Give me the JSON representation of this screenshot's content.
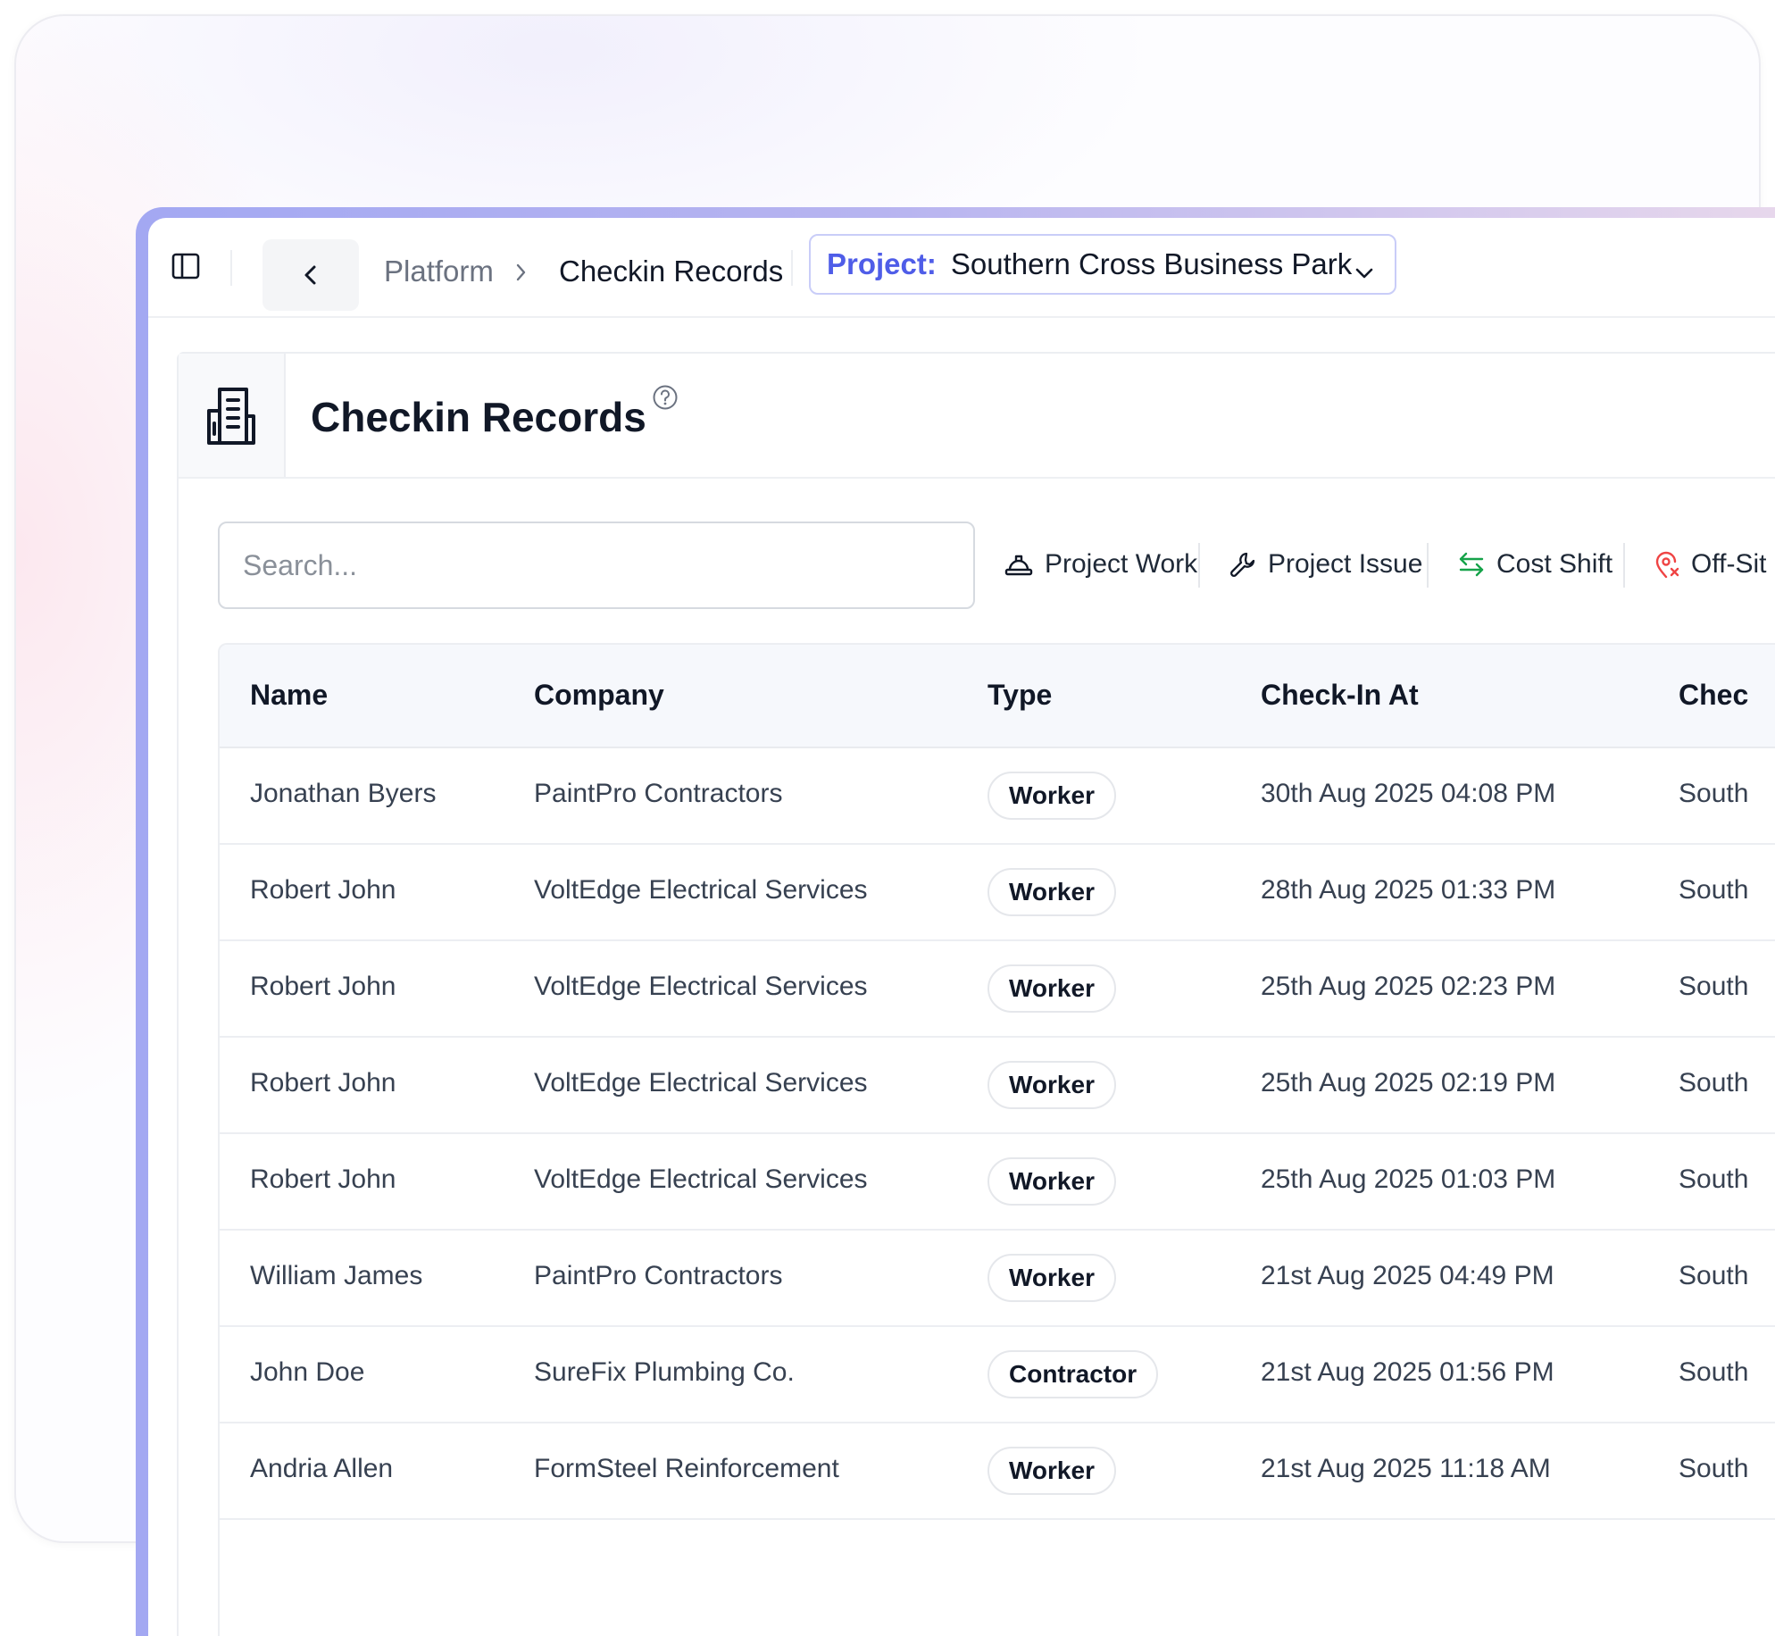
{
  "topbar": {
    "breadcrumb": [
      "Platform",
      "Checkin Records"
    ],
    "project_label": "Project:",
    "project_value": "Southern Cross Business Park"
  },
  "page": {
    "title": "Checkin Records"
  },
  "search": {
    "placeholder": "Search..."
  },
  "actions": [
    {
      "label": "Project Work",
      "icon": "hard-hat-icon"
    },
    {
      "label": "Project Issue",
      "icon": "wrench-icon"
    },
    {
      "label": "Cost Shift",
      "icon": "arrows-swap-icon"
    },
    {
      "label": "Off-Sit",
      "icon": "location-off-icon"
    }
  ],
  "colors": {
    "accent": "#4f5de8",
    "offsite_icon": "#ef4444",
    "cost_shift_icon": "#16a34a"
  },
  "table": {
    "columns": [
      "Name",
      "Company",
      "Type",
      "Check-In At",
      "Chec"
    ],
    "rows": [
      {
        "name": "Jonathan Byers",
        "company": "PaintPro Contractors",
        "type": "Worker",
        "checkin": "30th Aug 2025 04:08 PM",
        "site": "South"
      },
      {
        "name": "Robert John",
        "company": "VoltEdge Electrical Services",
        "type": "Worker",
        "checkin": "28th Aug 2025 01:33 PM",
        "site": "South"
      },
      {
        "name": "Robert John",
        "company": "VoltEdge Electrical Services",
        "type": "Worker",
        "checkin": "25th Aug 2025 02:23 PM",
        "site": "South"
      },
      {
        "name": "Robert John",
        "company": "VoltEdge Electrical Services",
        "type": "Worker",
        "checkin": "25th Aug 2025 02:19 PM",
        "site": "South"
      },
      {
        "name": "Robert John",
        "company": "VoltEdge Electrical Services",
        "type": "Worker",
        "checkin": "25th Aug 2025 01:03 PM",
        "site": "South"
      },
      {
        "name": "William James",
        "company": "PaintPro Contractors",
        "type": "Worker",
        "checkin": "21st Aug 2025 04:49 PM",
        "site": "South"
      },
      {
        "name": "John Doe",
        "company": "SureFix Plumbing Co.",
        "type": "Contractor",
        "checkin": "21st Aug 2025 01:56 PM",
        "site": "South"
      },
      {
        "name": "Andria Allen",
        "company": "FormSteel Reinforcement",
        "type": "Worker",
        "checkin": "21st Aug 2025 11:18 AM",
        "site": "South"
      }
    ]
  }
}
